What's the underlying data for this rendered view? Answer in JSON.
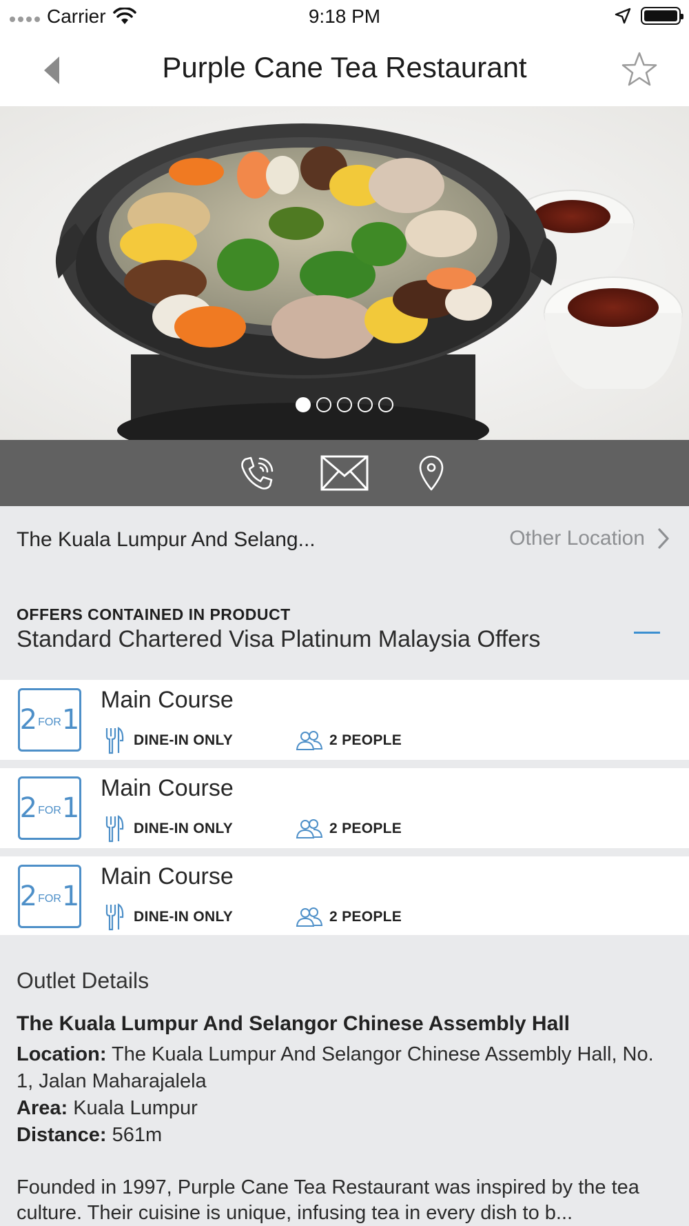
{
  "status_bar": {
    "carrier": "Carrier",
    "time": "9:18 PM"
  },
  "nav": {
    "title": "Purple Cane Tea Restaurant"
  },
  "gallery": {
    "page_count": 5,
    "current_page": 1
  },
  "location": {
    "name": "The Kuala Lumpur And Selang...",
    "other_label": "Other Location"
  },
  "offers": {
    "kicker": "OFFERS CONTAINED IN PRODUCT",
    "title": "Standard Chartered Visa Platinum Malaysia Offers",
    "items": [
      {
        "badge_two": "2",
        "badge_for": "FOR",
        "badge_one": "1",
        "name": "Main Course",
        "dine": "DINE-IN ONLY",
        "people": "2 PEOPLE"
      },
      {
        "badge_two": "2",
        "badge_for": "FOR",
        "badge_one": "1",
        "name": "Main Course",
        "dine": "DINE-IN ONLY",
        "people": "2 PEOPLE"
      },
      {
        "badge_two": "2",
        "badge_for": "FOR",
        "badge_one": "1",
        "name": "Main Course",
        "dine": "DINE-IN ONLY",
        "people": "2 PEOPLE"
      }
    ]
  },
  "outlet": {
    "heading": "Outlet Details",
    "name": "The Kuala Lumpur And Selangor Chinese Assembly Hall",
    "location_label": "Location:",
    "location_value": " The Kuala Lumpur And Selangor Chinese Assembly Hall, No. 1, Jalan Maharajalela",
    "area_label": "Area:",
    "area_value": " Kuala Lumpur",
    "distance_label": "Distance:",
    "distance_value": " 561m",
    "description": "Founded in 1997, Purple Cane Tea Restaurant was inspired by the tea culture. Their cuisine is unique, infusing tea in every dish to b..."
  },
  "colors": {
    "accent": "#3b8fd0",
    "action_bar": "#616161",
    "section_bg": "#e9eaec"
  }
}
